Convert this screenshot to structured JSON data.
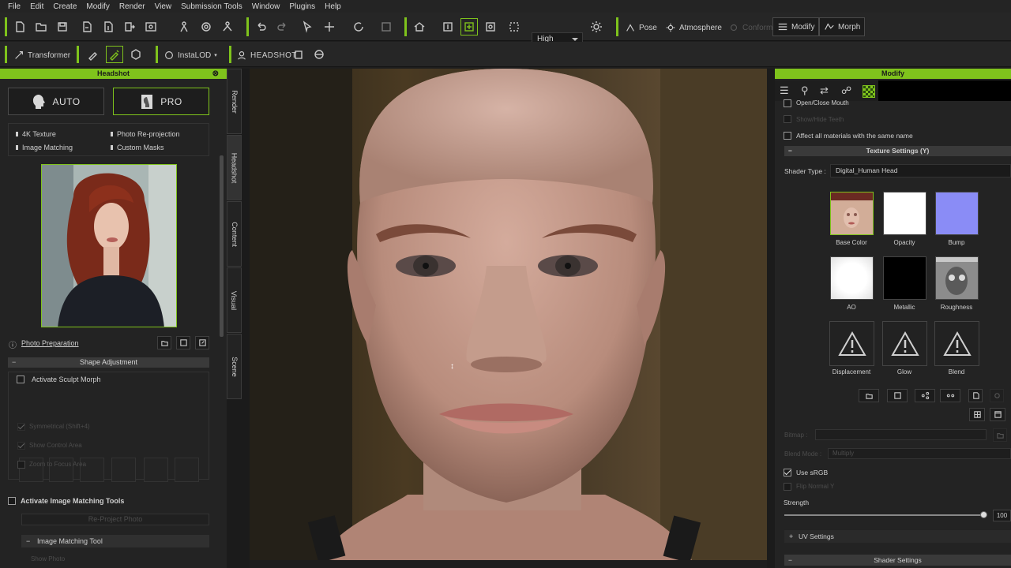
{
  "menu": [
    "File",
    "Edit",
    "Create",
    "Modify",
    "Render",
    "View",
    "Submission Tools",
    "Window",
    "Plugins",
    "Help"
  ],
  "toolbar": {
    "quality": "High",
    "pose": "Pose",
    "atmosphere": "Atmosphere",
    "conform": "Conform",
    "modify": "Modify",
    "morph": "Morph",
    "transformer": "Transformer",
    "instalod": "InstaLOD",
    "headshot": "HEADSHOT"
  },
  "left_panel": {
    "title": "Headshot",
    "auto": "AUTO",
    "pro": "PRO",
    "features": [
      "4K Texture",
      "Photo Re-projection",
      "Image Matching",
      "Custom Masks"
    ],
    "photo_prep": "Photo Preparation",
    "shape_adjustment": "Shape Adjustment",
    "activate_sculpt": "Activate Sculpt Morph",
    "symmetrical": "Symmetrical (Shift+4)",
    "show_control": "Show Control Area",
    "zoom_focus": "Zoom to Focus Area",
    "activate_matching": "Activate Image Matching Tools",
    "reproject": "Re-Project Photo",
    "image_matching_tool": "Image Matching Tool",
    "show_photo": "Show Photo"
  },
  "vtabs": [
    "Render",
    "Headshot",
    "Content",
    "Visual",
    "Scene"
  ],
  "right_panel": {
    "title": "Modify",
    "open_close_mouth": "Open/Close Mouth",
    "show_hide_teeth": "Show/Hide Teeth",
    "affect_all": "Affect all materials with the same name",
    "texture_settings": "Texture Settings  (Y)",
    "shader_type_label": "Shader Type :",
    "shader_type": "Digital_Human Head",
    "textures": [
      "Base Color",
      "Opacity",
      "Bump",
      "AO",
      "Metallic",
      "Roughness",
      "Displacement",
      "Glow",
      "Blend"
    ],
    "bitmap": "Bitmap :",
    "blend_mode": "Blend Mode :",
    "blend_value": "Multiply",
    "use_srgb": "Use sRGB",
    "flip_normal": "Flip Normal Y",
    "strength": "Strength",
    "strength_value": "100",
    "strength_fraction": 1.0,
    "uv_settings": "UV Settings",
    "shader_settings": "Shader Settings"
  },
  "colors": {
    "accent": "#7fc31c",
    "panel": "#232323"
  }
}
